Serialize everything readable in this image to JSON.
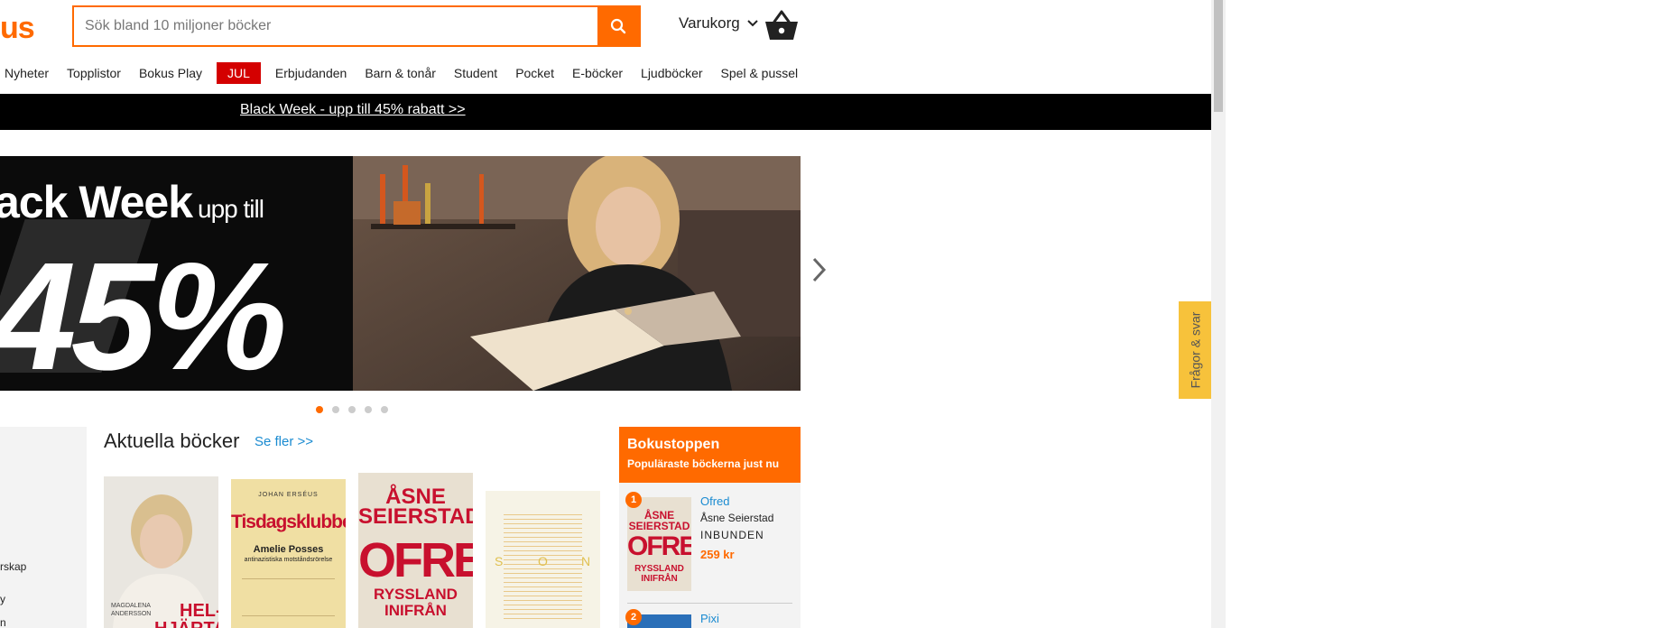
{
  "header": {
    "logo_text": "us",
    "search": {
      "placeholder": "Sök bland 10 miljoner böcker"
    },
    "cart_label": "Varukorg"
  },
  "nav": {
    "items": [
      "Nyheter",
      "Topplistor",
      "Bokus Play",
      "JUL",
      "Erbjudanden",
      "Barn & tonår",
      "Student",
      "Pocket",
      "E-böcker",
      "Ljudböcker",
      "Spel & pussel"
    ]
  },
  "banner": {
    "link_text": "Black Week - upp till 45% rabatt >>"
  },
  "hero": {
    "headline": "ack Week",
    "sub": "upp till",
    "percent": "45%",
    "slides_total": 5,
    "active_slide": 1
  },
  "sidebar": {
    "items": [
      "rskap",
      "y",
      "n"
    ]
  },
  "aktuella": {
    "title": "Aktuella böcker",
    "more_link": "Se fler >>",
    "books": [
      {
        "lines": [
          "MAGDALENA",
          "ANDERSSON",
          "HEL-",
          "HJÄRTAT"
        ]
      },
      {
        "lines": [
          "JOHAN ERSÉUS",
          "Tisdagsklubben",
          "Amelie Posses",
          "antinazistiska motståndsrörelse"
        ]
      },
      {
        "lines": [
          "ÅSNE",
          "SEIERSTAD",
          "OFRED",
          "RYSSLAND",
          "INIFRÅN"
        ]
      },
      {
        "lines": [
          "S",
          "O",
          "N"
        ]
      }
    ]
  },
  "bokustoppen": {
    "title": "Bokustoppen",
    "subtitle": "Populäraste böckerna just nu",
    "items": [
      {
        "rank": "1",
        "title": "Ofred",
        "author": "Åsne Seierstad",
        "format": "INBUNDEN",
        "price": "259 kr",
        "cover_lines": [
          "ÅSNE",
          "SEIERSTAD",
          "OFRED",
          "RYSSLAND",
          "INIFRÅN"
        ]
      },
      {
        "rank": "2",
        "title": "Pixi"
      }
    ]
  },
  "faq": {
    "label": "Frågor & svar"
  },
  "colors": {
    "brand_orange": "#ff6a00",
    "jul_red": "#d40000",
    "link_blue": "#1a8bd1",
    "faq_yellow": "#f7c23b"
  }
}
